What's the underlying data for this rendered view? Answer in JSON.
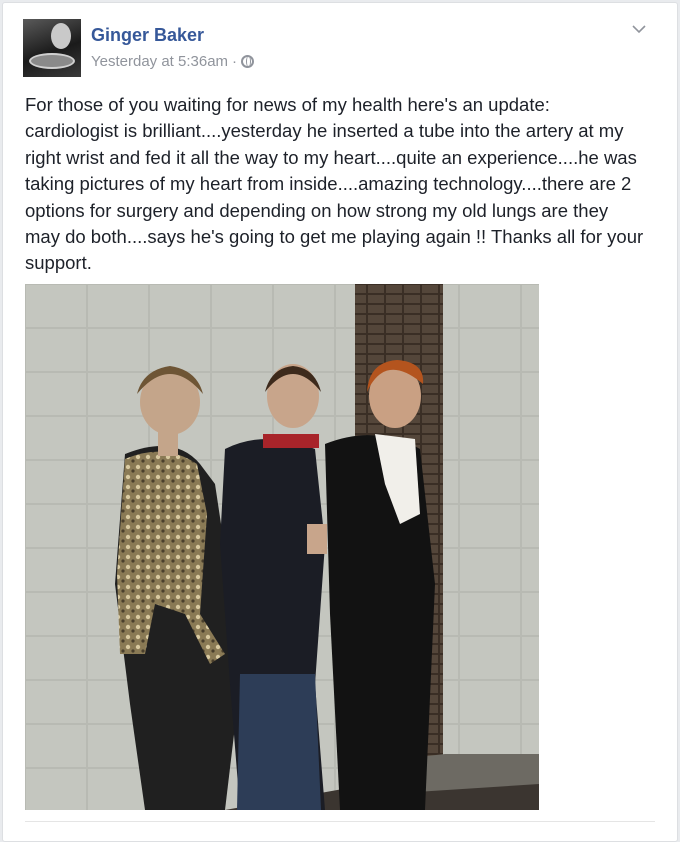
{
  "post": {
    "author": "Ginger Baker",
    "timestamp": "Yesterday at 5:36am",
    "separator": "·",
    "privacy_icon": "globe-icon",
    "options_icon": "chevron-down-icon",
    "text": "For those of you waiting for news of my health here's an update:\ncardiologist is brilliant....yesterday he inserted a tube into the artery at my\nright wrist and fed it all the way to my heart....quite an experience....he was\ntaking pictures of my heart from inside....amazing technology....there are 2\noptions for surgery and depending on how strong my old lungs are they\nmay do both....says he's going to get me playing again !! Thanks all for your\nsupport."
  },
  "colors": {
    "author_link": "#365899",
    "meta_text": "#90949c",
    "body_text": "#1d2129",
    "page_background": "#e9ebee"
  }
}
